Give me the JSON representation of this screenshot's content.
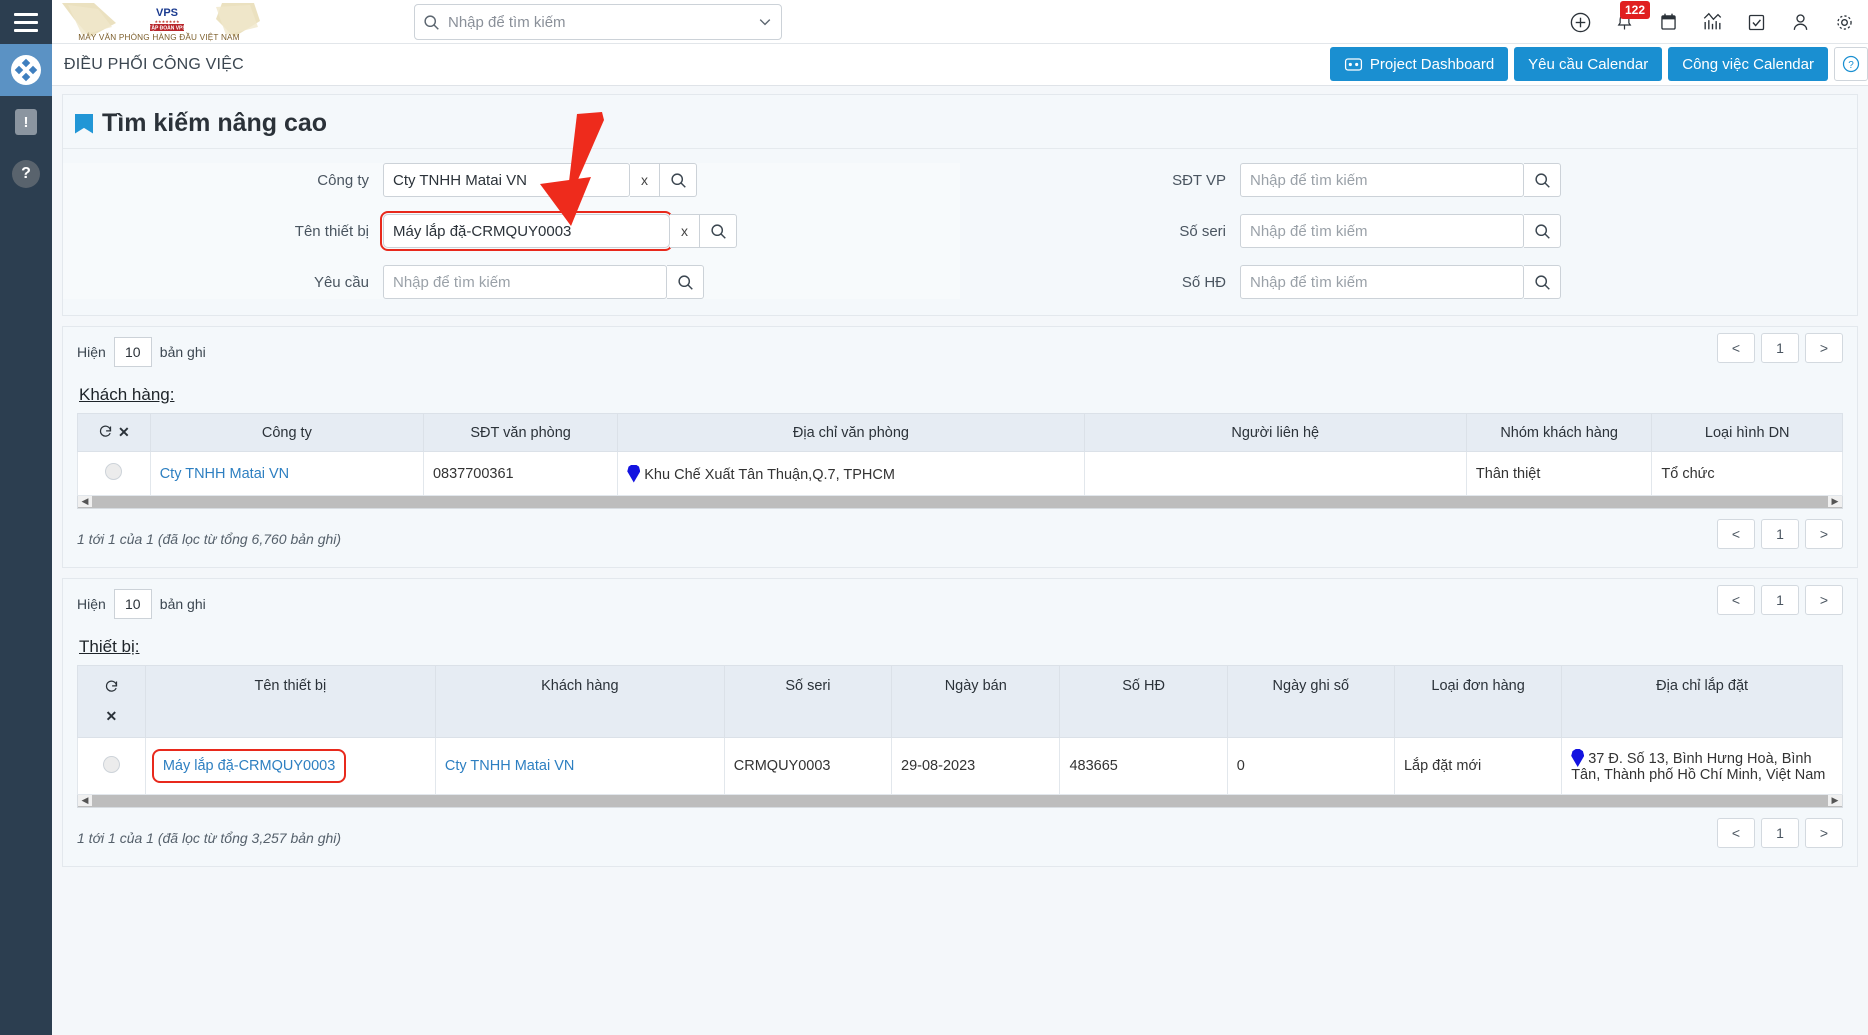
{
  "left_rail": {
    "menu_icon": "hamburger-icon",
    "items": [
      {
        "name": "app-logo-icon",
        "label": ""
      },
      {
        "name": "alert-icon",
        "label": "!"
      },
      {
        "name": "help-icon",
        "label": "?"
      }
    ]
  },
  "topbar": {
    "brand_tagline": "MÁY VĂN PHÒNG HÀNG ĐẦU VIỆT NAM",
    "brand_mark": "VPS",
    "brand_sub": "TẬP ĐOÀN VPS",
    "search": {
      "placeholder": "Nhập để tìm kiếm",
      "value": "",
      "icon": "search-icon"
    },
    "icons": [
      {
        "name": "add-circle-icon"
      },
      {
        "name": "bell-icon",
        "badge": "122"
      },
      {
        "name": "calendar-icon"
      },
      {
        "name": "chart-icon"
      },
      {
        "name": "checkbox-icon"
      },
      {
        "name": "user-icon"
      },
      {
        "name": "gear-icon"
      }
    ]
  },
  "header": {
    "title": "ĐIỀU PHỐI CÔNG VIỆC",
    "buttons": [
      {
        "name": "project-dashboard-button",
        "label": "Project Dashboard",
        "icon": "dashboard-icon"
      },
      {
        "name": "yeu-cau-calendar-button",
        "label": "Yêu cầu Calendar"
      },
      {
        "name": "cong-viec-calendar-button",
        "label": "Công việc Calendar"
      }
    ],
    "help_icon": "question-circle-icon",
    "accent_color": "#1a8fd1"
  },
  "search_panel": {
    "title": "Tìm kiếm nâng cao",
    "fields_left": [
      {
        "name": "cong-ty-field",
        "label": "Công ty",
        "value": "Cty TNHH Matai VN",
        "placeholder": "",
        "has_clear": true,
        "highlight": false
      },
      {
        "name": "ten-thiet-bi-field",
        "label": "Tên thiết bị",
        "value": "Máy lắp đặ-CRMQUY0003",
        "placeholder": "",
        "has_clear": true,
        "highlight": true
      },
      {
        "name": "yeu-cau-field",
        "label": "Yêu cầu",
        "value": "",
        "placeholder": "Nhập để tìm kiếm",
        "has_clear": false,
        "highlight": false
      }
    ],
    "fields_right": [
      {
        "name": "sdt-vp-field",
        "label": "SĐT VP",
        "value": "",
        "placeholder": "Nhập để tìm kiếm",
        "has_clear": false,
        "highlight": false
      },
      {
        "name": "so-seri-field",
        "label": "Số seri",
        "value": "",
        "placeholder": "Nhập để tìm kiếm",
        "has_clear": false,
        "highlight": false
      },
      {
        "name": "so-hd-field",
        "label": "Số HĐ",
        "value": "",
        "placeholder": "Nhập để tìm kiếm",
        "has_clear": false,
        "highlight": false
      }
    ],
    "clear_label": "x"
  },
  "customer_block": {
    "show_prefix": "Hiện",
    "show_value": "10",
    "show_suffix": "bản ghi",
    "pager": {
      "prev": "<",
      "page": "1",
      "next": ">"
    },
    "table_label": "Khách hàng:",
    "columns": [
      "",
      "Công ty",
      "SĐT văn phòng",
      "Địa chỉ văn phòng",
      "Người liên hệ",
      "Nhóm khách hàng",
      "Loại hình DN"
    ],
    "rows": [
      {
        "cong_ty": "Cty TNHH Matai VN",
        "sdt": "0837700361",
        "dia_chi": "Khu Chế Xuất Tân Thuận,Q.7, TPHCM",
        "nguoi_lien_he": "",
        "nhom": "Thân thiệt",
        "loai_hinh": "Tổ chức"
      }
    ],
    "footer_info": "1 tới 1 của 1 (đã lọc từ tổng 6,760 bản ghi)"
  },
  "device_block": {
    "show_prefix": "Hiện",
    "show_value": "10",
    "show_suffix": "bản ghi",
    "pager": {
      "prev": "<",
      "page": "1",
      "next": ">"
    },
    "table_label": "Thiết bị:",
    "columns": [
      "",
      "Tên thiết bị",
      "Khách hàng",
      "Số seri",
      "Ngày bán",
      "Số HĐ",
      "Ngày ghi số",
      "Loại đơn hàng",
      "Địa chỉ lắp đặt"
    ],
    "rows": [
      {
        "ten_thiet_bi": "Máy lắp đặ-CRMQUY0003",
        "khach_hang": "Cty TNHH Matai VN",
        "so_seri": "CRMQUY0003",
        "ngay_ban": "29-08-2023",
        "so_hd": "483665",
        "ngay_ghi_so": "0",
        "loai_don_hang": "Lắp đặt mới",
        "dia_chi_lap_dat": "37 Đ. Số 13, Bình Hưng Hoà, Bình Tân, Thành phố Hồ Chí Minh, Việt Nam",
        "highlight_name": true
      }
    ],
    "footer_info": "1 tới 1 của 1 (đã lọc từ tổng 3,257 bản ghi)"
  },
  "annotation": {
    "arrow_color": "#ee2b1c",
    "highlight_color": "#e8291c"
  }
}
